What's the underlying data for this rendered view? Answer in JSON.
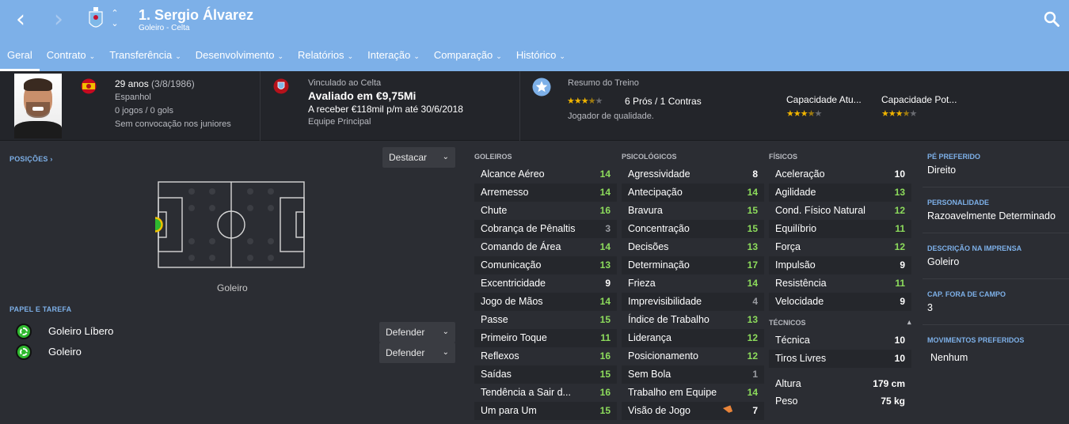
{
  "header": {
    "title": "1. Sergio Álvarez",
    "subtitle": "Goleiro - Celta",
    "back_icon": "chevron-left-icon",
    "forward_icon": "chevron-right-icon",
    "search_icon": "search-icon",
    "accent": "#7db0e8"
  },
  "tabs": [
    {
      "label": "Geral",
      "active": true
    },
    {
      "label": "Contrato"
    },
    {
      "label": "Transferência"
    },
    {
      "label": "Desenvolvimento"
    },
    {
      "label": "Relatórios"
    },
    {
      "label": "Interação"
    },
    {
      "label": "Comparação"
    },
    {
      "label": "Histórico"
    }
  ],
  "info": {
    "age": "29 anos",
    "birth": "(3/8/1986)",
    "nationality": "Espanhol",
    "caps": "0 jogos / 0 gols",
    "youth": "Sem convocação nos juniores",
    "contract_label": "Vinculado ao Celta",
    "value": "Avaliado em €9,75Mi",
    "wage": "A receber €118mil p/m até 30/6/2018",
    "squad": "Equipe Principal",
    "training_label": "Resumo do Treino",
    "training_stars": 3.5,
    "pros_cons": "6 Prós / 1 Contras",
    "quality": "Jogador de qualidade.",
    "current_ability_label": "Capacidade Atu...",
    "current_ability_stars": 3.5,
    "potential_ability_label": "Capacidade Pot...",
    "potential_ability_stars": 3.5
  },
  "positions": {
    "label": "POSIÇÕES",
    "highlight_dropdown": "Destacar",
    "position_name": "Goleiro"
  },
  "roles": {
    "label": "PAPEL E TAREFA",
    "items": [
      {
        "name": "Goleiro Líbero",
        "duty": "Defender"
      },
      {
        "name": "Goleiro",
        "duty": "Defender"
      }
    ]
  },
  "goalkeeping": {
    "title": "GOLEIROS",
    "items": [
      {
        "name": "Alcance Aéreo",
        "value": "14"
      },
      {
        "name": "Arremesso",
        "value": "14"
      },
      {
        "name": "Chute",
        "value": "16"
      },
      {
        "name": "Cobrança de Pênaltis",
        "value": "3"
      },
      {
        "name": "Comando de Área",
        "value": "14"
      },
      {
        "name": "Comunicação",
        "value": "13"
      },
      {
        "name": "Excentricidade",
        "value": "9"
      },
      {
        "name": "Jogo de Mãos",
        "value": "14"
      },
      {
        "name": "Passe",
        "value": "15"
      },
      {
        "name": "Primeiro Toque",
        "value": "11"
      },
      {
        "name": "Reflexos",
        "value": "16"
      },
      {
        "name": "Saídas",
        "value": "15"
      },
      {
        "name": "Tendência a Sair d...",
        "value": "16"
      },
      {
        "name": "Um para Um",
        "value": "15"
      }
    ]
  },
  "mental": {
    "title": "PSICOLÓGICOS",
    "items": [
      {
        "name": "Agressividade",
        "value": "8"
      },
      {
        "name": "Antecipação",
        "value": "14"
      },
      {
        "name": "Bravura",
        "value": "15"
      },
      {
        "name": "Concentração",
        "value": "15"
      },
      {
        "name": "Decisões",
        "value": "13"
      },
      {
        "name": "Determinação",
        "value": "17"
      },
      {
        "name": "Frieza",
        "value": "14"
      },
      {
        "name": "Imprevisibilidade",
        "value": "4"
      },
      {
        "name": "Índice de Trabalho",
        "value": "13"
      },
      {
        "name": "Liderança",
        "value": "12"
      },
      {
        "name": "Posicionamento",
        "value": "12"
      },
      {
        "name": "Sem Bola",
        "value": "1"
      },
      {
        "name": "Trabalho em Equipe",
        "value": "14"
      },
      {
        "name": "Visão de Jogo",
        "value": "7"
      }
    ]
  },
  "physical": {
    "title": "FÍSICOS",
    "items": [
      {
        "name": "Aceleração",
        "value": "10"
      },
      {
        "name": "Agilidade",
        "value": "13"
      },
      {
        "name": "Cond. Físico Natural",
        "value": "12"
      },
      {
        "name": "Equilíbrio",
        "value": "11"
      },
      {
        "name": "Força",
        "value": "12"
      },
      {
        "name": "Impulsão",
        "value": "9"
      },
      {
        "name": "Resistência",
        "value": "11"
      },
      {
        "name": "Velocidade",
        "value": "9"
      }
    ]
  },
  "technical": {
    "title": "TÉCNICOS",
    "items": [
      {
        "name": "Técnica",
        "value": "10"
      },
      {
        "name": "Tiros Livres",
        "value": "10"
      }
    ]
  },
  "body": {
    "height_label": "Altura",
    "height": "179 cm",
    "weight_label": "Peso",
    "weight": "75 kg"
  },
  "details": [
    {
      "label": "PÉ PREFERIDO",
      "value": "Direito"
    },
    {
      "label": "PERSONALIDADE",
      "value": "Razoavelmente Determinado"
    },
    {
      "label": "DESCRIÇÃO NA IMPRENSA",
      "value": "Goleiro"
    },
    {
      "label": "CAP. FORA DE CAMPO",
      "value": "3"
    },
    {
      "label": "MOVIMENTOS PREFERIDOS",
      "value": "Nenhum"
    }
  ]
}
